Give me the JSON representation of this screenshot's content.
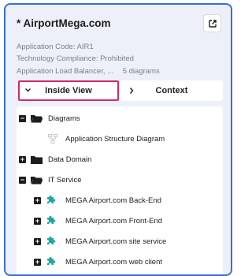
{
  "card": {
    "title": "* AirportMega.com",
    "meta": [
      {
        "text": "Application Code: AIR1"
      },
      {
        "text": "Technology Compliance: Prohibited"
      },
      {
        "label": "Application Load Balancer, ...",
        "value": "5 diagrams"
      }
    ]
  },
  "tabs": [
    {
      "label": "Inside View",
      "active": true
    },
    {
      "label": "Context",
      "active": false
    }
  ],
  "tree": {
    "diagrams_folder": "Diagrams",
    "diagram_item": "Application Structure Diagram",
    "data_domain_folder": "Data Domain",
    "it_service_folder": "IT Service",
    "services": [
      "MEGA Airport.com Back-End",
      "MEGA Airport.com Front-End",
      "MEGA Airport.com site service",
      "MEGA Airport.com web client"
    ]
  },
  "colors": {
    "panel_bg": "#edf0f9",
    "panel_border": "#3a6fd0",
    "active_tab_outline": "#d4286d",
    "service_icon": "#1ca8a0"
  },
  "icons": {
    "open": "external-link-icon",
    "folder": "folder-icon",
    "diagram": "diagram-icon",
    "service": "puzzle-icon"
  }
}
